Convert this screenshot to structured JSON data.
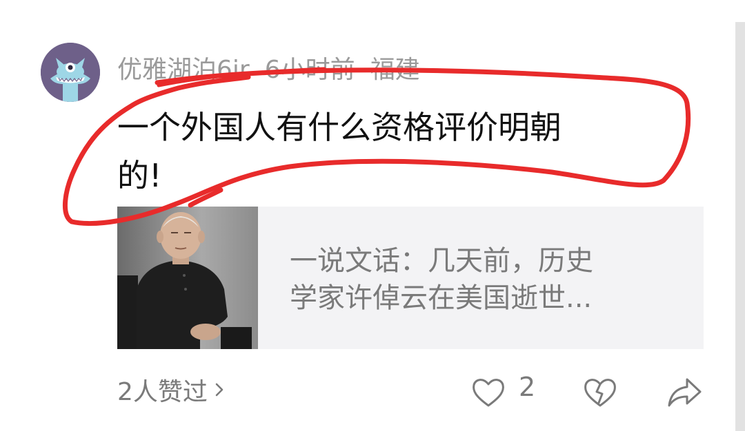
{
  "comment": {
    "username": "优雅湖泊6ir",
    "time": "6小时前",
    "location": "福建",
    "text_line1": "一个外国人有什么资格评价明朝",
    "text_line2": "的!"
  },
  "link_card": {
    "line1": "一说文话：几天前，历史",
    "line2": "学家许倬云在美国逝世..."
  },
  "footer": {
    "likes_text": "2人赞过",
    "like_count": "2"
  },
  "icons": {
    "avatar": "monster-avatar-icon",
    "like": "heart-icon",
    "dislike": "broken-heart-icon",
    "share": "share-arrow-icon",
    "chevron": "chevron-right-icon"
  },
  "colors": {
    "annotation": "#e82b2b",
    "avatar_bg": "#6e6089",
    "card_bg": "#f3f3f5",
    "meta_text": "#9a9a9a",
    "secondary_text": "#7a7a7a"
  }
}
